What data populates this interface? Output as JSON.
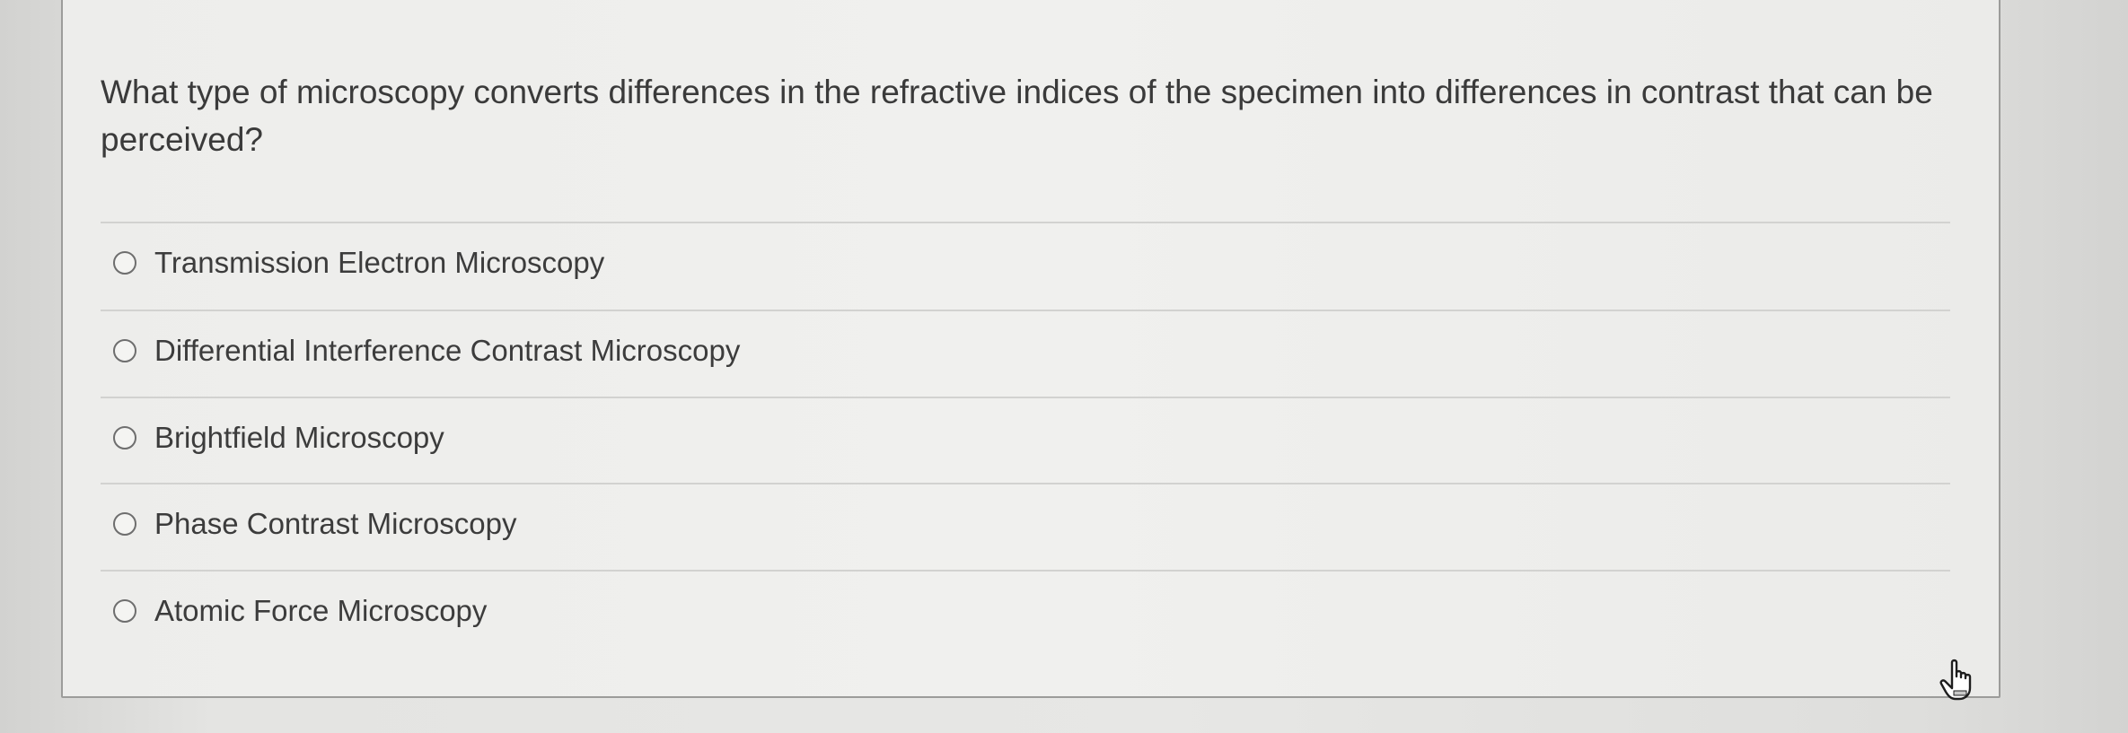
{
  "question": {
    "text": "What type of microscopy converts differences in the refractive indices of the specimen into differences in contrast that can be perceived?"
  },
  "answers": [
    {
      "label": "Transmission Electron Microscopy",
      "selected": false
    },
    {
      "label": "Differential Interference Contrast Microscopy",
      "selected": false
    },
    {
      "label": "Brightfield Microscopy",
      "selected": false
    },
    {
      "label": "Phase Contrast Microscopy",
      "selected": false
    },
    {
      "label": "Atomic Force Microscopy",
      "selected": false
    }
  ],
  "icons": {
    "radio": "radio-unchecked-icon",
    "cursor": "hand-pointer-icon"
  },
  "colors": {
    "text": "#3a3a3a",
    "card_border": "#9c9c9a",
    "divider": "#d2d2d0",
    "radio_border": "#6e6e6e"
  }
}
